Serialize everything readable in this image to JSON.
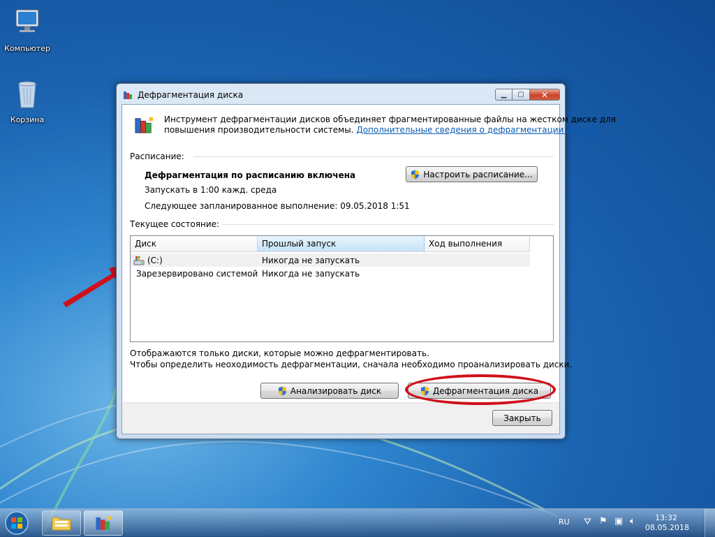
{
  "desktop": {
    "icons": [
      {
        "label": "Компьютер",
        "icon": "computer-icon"
      },
      {
        "label": "Корзина",
        "icon": "recycle-bin-icon"
      }
    ]
  },
  "window": {
    "title": "Дефрагментация диска",
    "intro_text": "Инструмент дефрагментации дисков объединяет фрагментированные файлы на жестком диске для",
    "intro_text_2": "повышения производительности системы.",
    "intro_link": "Дополнительные сведения о дефрагментации дисков.",
    "schedule": {
      "heading": "Расписание:",
      "status": "Дефрагментация по расписанию включена",
      "run_at": "Запускать в 1:00 кажд. среда",
      "next_run": "Следующее запланированное выполнение: 09.05.2018 1:51",
      "configure_button": "Настроить расписание..."
    },
    "current_state": {
      "heading": "Текущее состояние:",
      "columns": [
        "Диск",
        "Прошлый запуск",
        "Ход выполнения"
      ],
      "rows": [
        {
          "disk": "(C:)",
          "last_run": "Никогда не запускать",
          "progress": "",
          "icon": "system-drive-icon"
        },
        {
          "disk": "Зарезервировано системой",
          "last_run": "Никогда не запускать",
          "progress": "",
          "icon": "drive-icon"
        }
      ]
    },
    "info_line_1": "Отображаются только диски, которые можно дефрагментировать.",
    "info_line_2": "Чтобы определить неоходимость  дефрагментации, сначала необходимо проанализировать диски.",
    "analyze_button": "Анализировать диск",
    "defrag_button": "Дефрагментация диска",
    "close_button": "Закрыть"
  },
  "taskbar": {
    "language": "RU",
    "time": "13:32",
    "date": "08.05.2018"
  },
  "colors": {
    "annotation_red": "#d0101b",
    "link_blue": "#0a5bb5"
  }
}
